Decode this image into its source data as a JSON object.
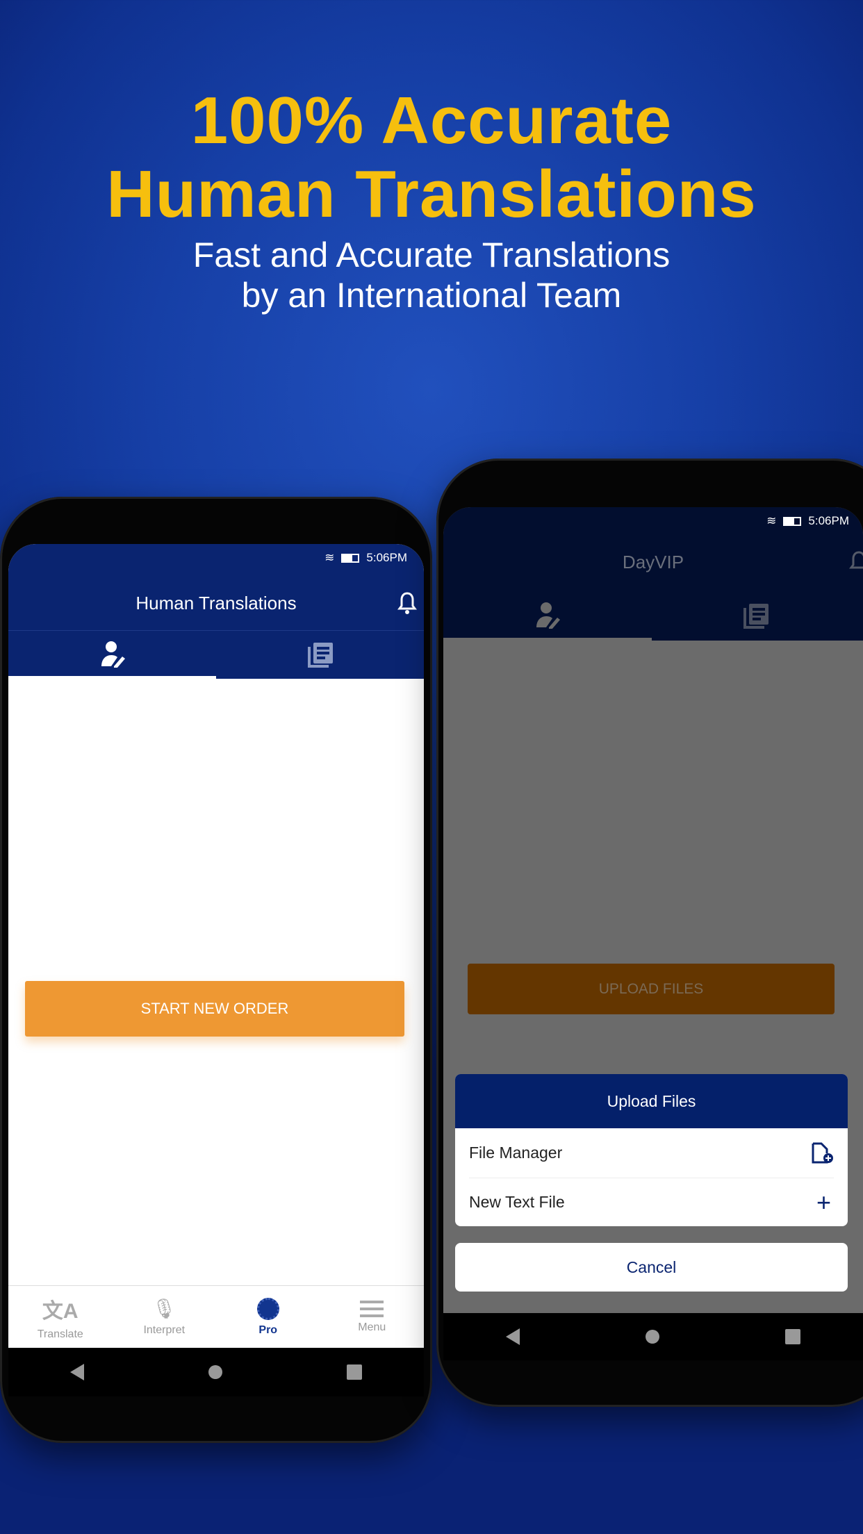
{
  "headline": {
    "line1": "100% Accurate",
    "line2": "Human Translations"
  },
  "subheadline": {
    "line1": "Fast and Accurate Translations",
    "line2": "by an International Team"
  },
  "colors": {
    "headline": "#f6bf0e",
    "app_blue": "#0a2470",
    "accent_orange": "#ee9833"
  },
  "left_phone": {
    "status_time": "5:06PM",
    "header_title": "Human Translations",
    "tabs": [
      {
        "icon": "person-edit-icon",
        "active": true
      },
      {
        "icon": "documents-icon",
        "active": false
      }
    ],
    "start_button": "START NEW ORDER",
    "bottom_nav": [
      {
        "label": "Translate",
        "icon": "translate-icon"
      },
      {
        "label": "Interpret",
        "icon": "interpret-icon"
      },
      {
        "label": "Pro",
        "icon": "pro-seal-icon",
        "active": true
      },
      {
        "label": "Menu",
        "icon": "menu-icon"
      }
    ]
  },
  "right_phone": {
    "status_time": "5:06PM",
    "header_title": "DayVIP",
    "upload_button": "UPLOAD FILES",
    "sheet": {
      "title": "Upload Files",
      "items": [
        {
          "label": "File Manager",
          "icon": "file-add-icon"
        },
        {
          "label": "New Text File",
          "icon": "plus-icon"
        }
      ],
      "cancel": "Cancel"
    }
  }
}
